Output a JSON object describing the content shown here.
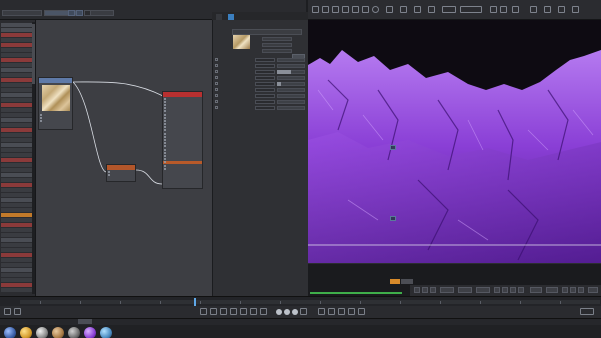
{
  "node_editor": {
    "tabs": [
      "",
      "",
      ""
    ],
    "nodes": {
      "texture": {
        "title": "",
        "ports": [
          "",
          "",
          ""
        ]
      },
      "displacement": {
        "title": "",
        "ports": [
          "",
          ""
        ]
      },
      "material": {
        "title": "",
        "ports": [
          "",
          "",
          "",
          "",
          "",
          "",
          "",
          "",
          "",
          "",
          "",
          "",
          "",
          "",
          "",
          "",
          "",
          "",
          "",
          "",
          "",
          "",
          ""
        ]
      }
    }
  },
  "attributes": {
    "tabs": [
      "",
      ""
    ],
    "header": "",
    "params": [
      "",
      "",
      "",
      "",
      "",
      "",
      "",
      "",
      ""
    ],
    "button": ""
  },
  "viewport": {
    "labels": [
      "",
      ""
    ],
    "colors": {
      "terrain_light": "#b57af0",
      "terrain_mid": "#8a3fd6",
      "terrain_dark": "#4b1a86",
      "sky": "#0e0b12"
    }
  },
  "console": {
    "lines": [
      "",
      "",
      "",
      ""
    ]
  },
  "material_manager": {
    "tabs": [
      "",
      "",
      "",
      "",
      "",
      "",
      ""
    ]
  },
  "timeline": {
    "playhead_fraction": 0.3
  }
}
